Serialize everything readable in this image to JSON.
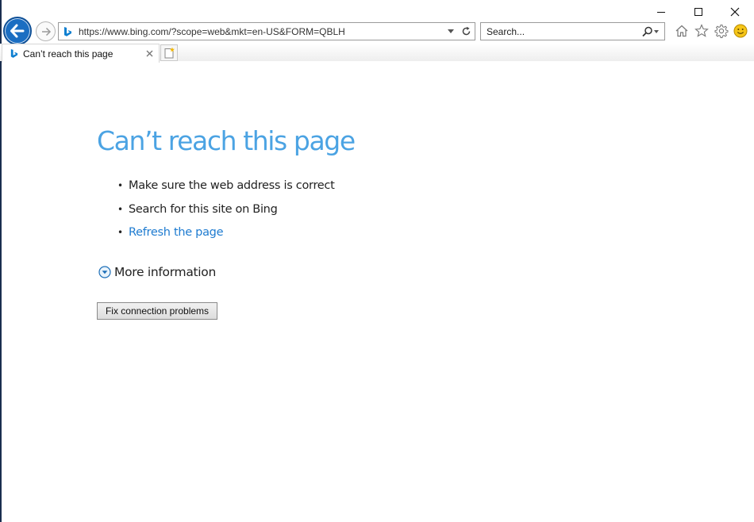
{
  "browser": {
    "address_url": "https://www.bing.com/?scope=web&mkt=en-US&FORM=QBLH",
    "search_placeholder": "Search...",
    "tab": {
      "label": "Can’t reach this page"
    },
    "icons": [
      "back-arrow-icon",
      "forward-arrow-icon",
      "bing-logo-icon",
      "dropdown-arrow-icon",
      "refresh-icon",
      "search-icon",
      "home-icon",
      "favorites-star-icon",
      "settings-gear-icon",
      "smiley-feedback-icon",
      "new-tab-icon",
      "close-icon",
      "minimize-icon",
      "maximize-icon"
    ],
    "colors": {
      "back_button": "#1b6ec2",
      "title_blue": "#4ba3e3",
      "link_blue": "#1e7bd0",
      "bing_teal": "#0e7fd0"
    }
  },
  "error_page": {
    "title": "Can’t reach this page",
    "bullets": [
      "Make sure the web address is correct",
      "Search for this site on Bing",
      "Refresh the page"
    ],
    "more_info": "More information",
    "fix_button": "Fix connection problems"
  }
}
